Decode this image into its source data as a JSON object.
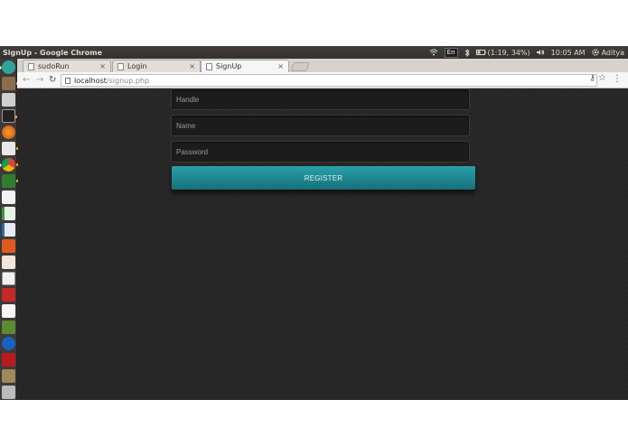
{
  "window": {
    "title": "SignUp - Google Chrome"
  },
  "panel": {
    "keyboard": "En",
    "battery": "(1:19, 34%)",
    "clock": "10:05 AM",
    "user": "Aditya"
  },
  "tabs": [
    {
      "label": "sudoRun",
      "close": "×"
    },
    {
      "label": "Login",
      "close": "×"
    },
    {
      "label": "SignUp",
      "close": "×"
    }
  ],
  "address": {
    "host": "localhost",
    "path": "/signup.php"
  },
  "form": {
    "handle_placeholder": "Handle",
    "name_placeholder": "Name",
    "password_placeholder": "Password",
    "submit_label": "REGISTER"
  },
  "colors": {
    "accent": "#1f8e96",
    "page_bg": "#262626"
  }
}
